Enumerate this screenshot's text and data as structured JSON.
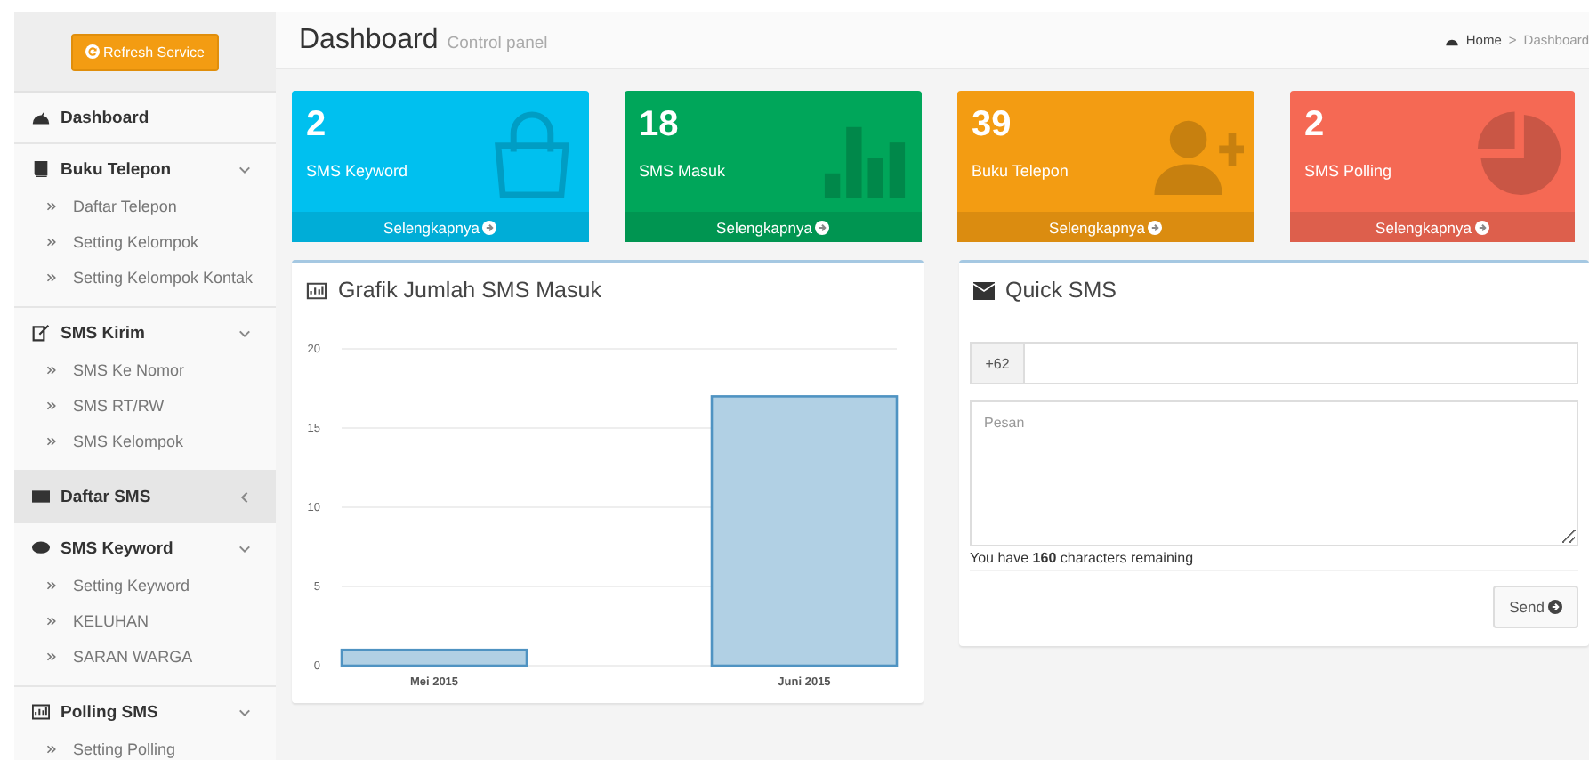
{
  "sidebar": {
    "refresh_button": "Refresh Service",
    "items": [
      {
        "label": "Dashboard",
        "selected": false
      },
      {
        "label": "Buku Telepon",
        "selected": false,
        "expanded": true,
        "children": [
          {
            "label": "Daftar Telepon"
          },
          {
            "label": "Setting Kelompok"
          },
          {
            "label": "Setting Kelompok Kontak"
          }
        ]
      },
      {
        "label": "SMS Kirim",
        "selected": false,
        "expanded": true,
        "children": [
          {
            "label": "SMS Ke Nomor"
          },
          {
            "label": "SMS RT/RW"
          },
          {
            "label": "SMS Kelompok"
          }
        ]
      },
      {
        "label": "Daftar SMS",
        "selected": true,
        "expanded": false
      },
      {
        "label": "SMS Keyword",
        "selected": false,
        "expanded": true,
        "children": [
          {
            "label": "Setting Keyword"
          },
          {
            "label": "KELUHAN"
          },
          {
            "label": "SARAN WARGA"
          }
        ]
      },
      {
        "label": "Polling SMS",
        "selected": false,
        "expanded": true,
        "children": [
          {
            "label": "Setting Polling"
          }
        ]
      }
    ]
  },
  "header": {
    "title": "Dashboard",
    "subtitle": "Control panel",
    "breadcrumb": [
      "Home",
      "Dashboard"
    ],
    "separator": ">"
  },
  "stat_boxes": [
    {
      "value": "2",
      "label": "SMS Keyword",
      "link": "Selengkapnya",
      "color": "#00c0ef",
      "kind": "bag"
    },
    {
      "value": "18",
      "label": "SMS Masuk",
      "link": "Selengkapnya",
      "color": "#00a65a",
      "kind": "bars"
    },
    {
      "value": "39",
      "label": "Buku Telepon",
      "link": "Selengkapnya",
      "color": "#f39c12",
      "kind": "user-add"
    },
    {
      "value": "2",
      "label": "SMS Polling",
      "link": "Selengkapnya",
      "color": "#f56954",
      "kind": "pie"
    }
  ],
  "chart_panel": {
    "title": "Grafik Jumlah SMS Masuk",
    "chart_data": {
      "type": "bar",
      "categories": [
        "Mei 2015",
        "Juni 2015"
      ],
      "values": [
        1,
        17
      ],
      "ylim": [
        0,
        20
      ],
      "grid": true,
      "yticks": [
        0,
        5,
        10,
        15,
        20
      ]
    }
  },
  "quick_sms": {
    "title": "Quick SMS",
    "prefix": "+62",
    "message_placeholder": "Pesan",
    "counter": "You have **160** characters remaining",
    "send_button": "Send"
  }
}
